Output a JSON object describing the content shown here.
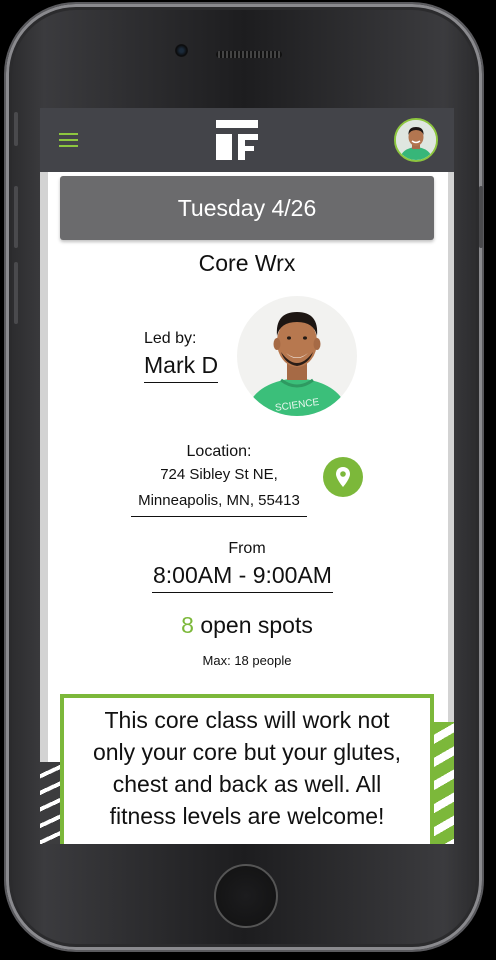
{
  "topbar": {
    "menu_icon": "hamburger-menu-icon",
    "logo_icon": "tf-logo-icon",
    "accent_color": "#8dc63f",
    "bar_color": "#434449"
  },
  "class_detail": {
    "date": "Tuesday 4/26",
    "title": "Core Wrx",
    "led_by_label": "Led by:",
    "instructor": "Mark D",
    "location_label": "Location:",
    "address_line1": "724 Sibley St NE,",
    "address_line2": "Minneapolis, MN, 55413",
    "from_label": "From",
    "time_range": "8:00AM - 9:00AM",
    "open_spots": "8",
    "open_spots_label": "open spots",
    "max": "Max: 18 people",
    "description": "This core class will work not only your core but your glutes, chest and back as well. All fitness levels are welcome!"
  }
}
